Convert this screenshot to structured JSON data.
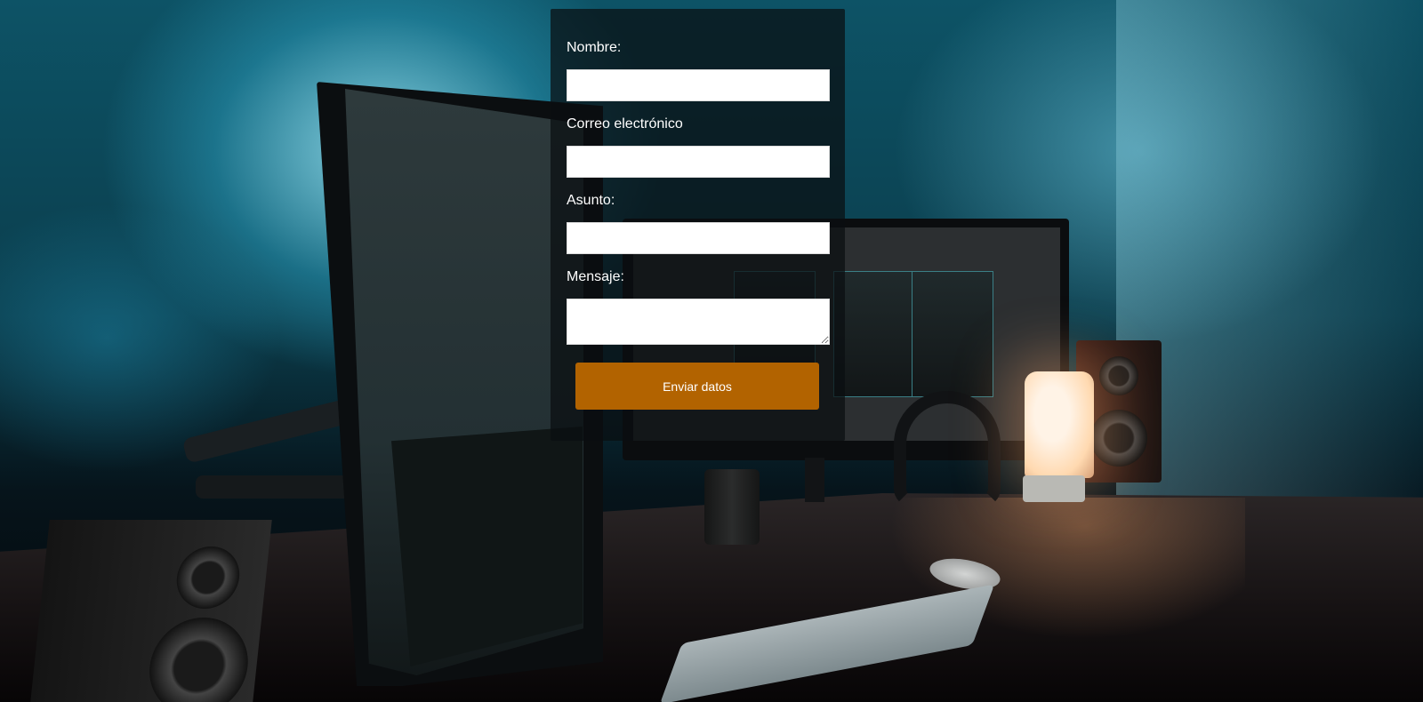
{
  "form": {
    "fields": [
      {
        "label": "Nombre:",
        "value": "",
        "placeholder": ""
      },
      {
        "label": "Correo electrónico",
        "value": "",
        "placeholder": ""
      },
      {
        "label": "Asunto:",
        "value": "",
        "placeholder": ""
      },
      {
        "label": "Mensaje:",
        "value": "",
        "placeholder": ""
      }
    ],
    "submit_label": "Enviar datos"
  },
  "colors": {
    "submit_button": "#b26300",
    "panel_overlay": "#0a0e10",
    "input_background": "#ffffff"
  }
}
